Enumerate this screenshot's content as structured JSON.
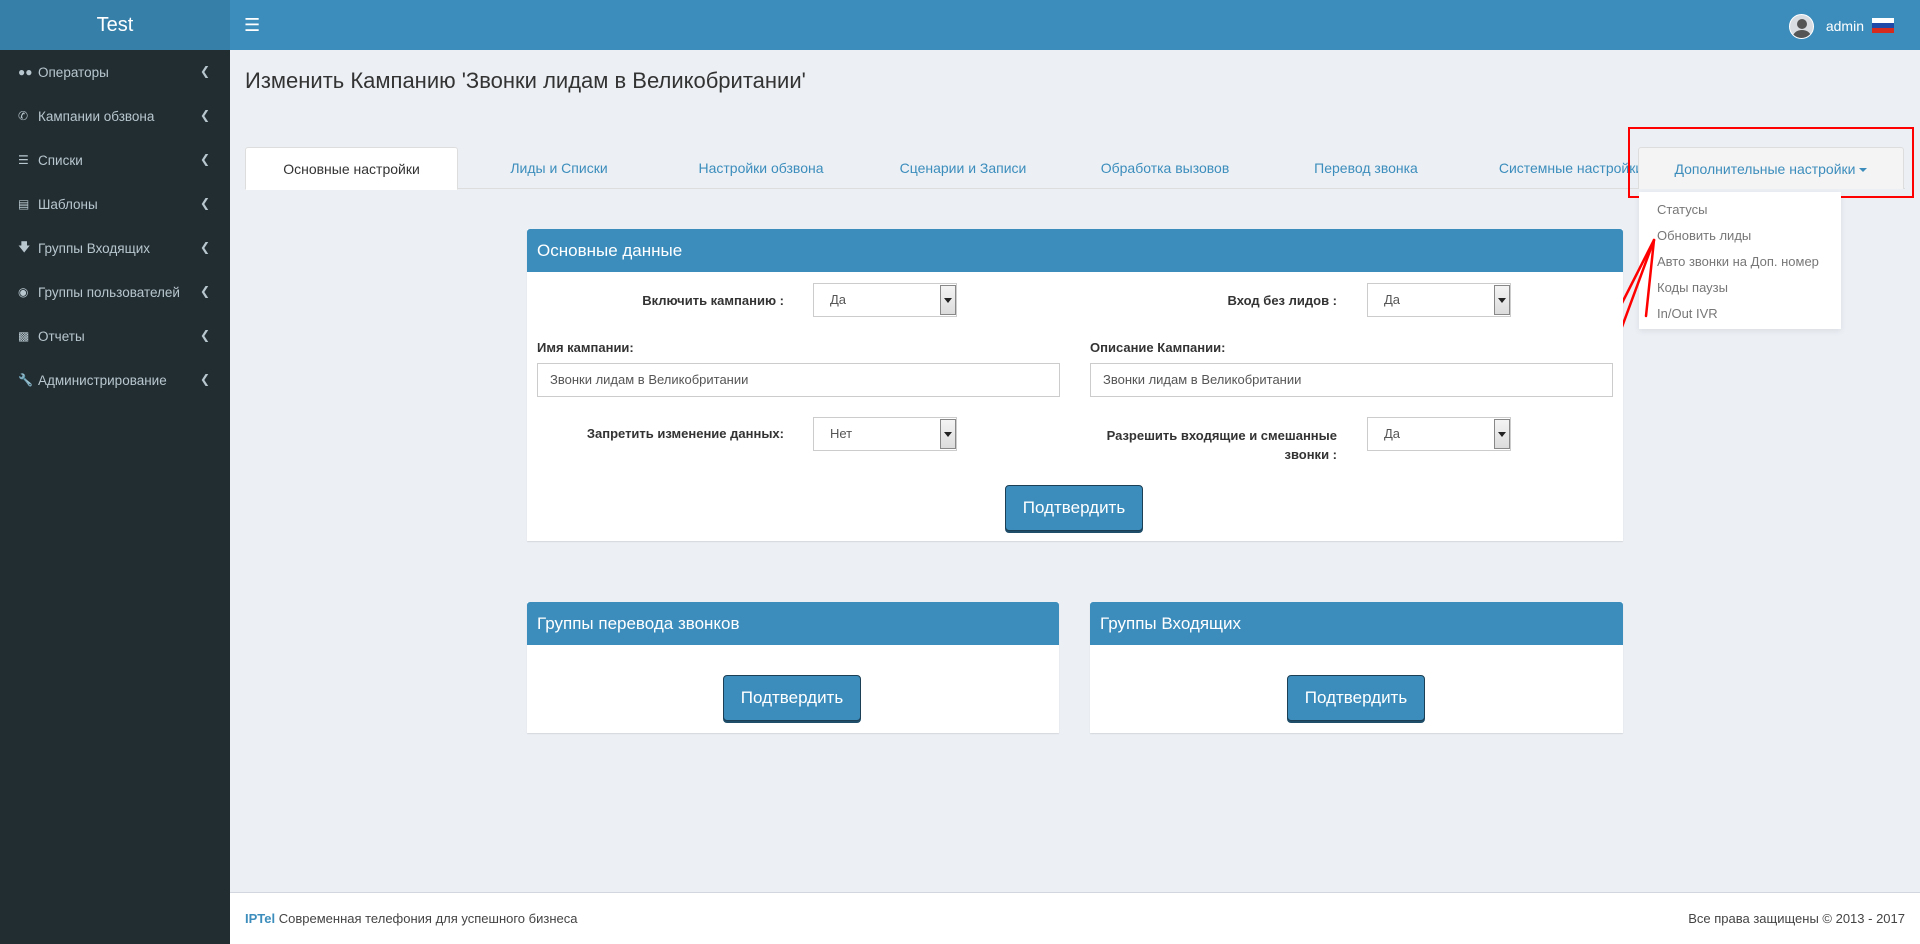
{
  "app": {
    "title": "Test"
  },
  "user": {
    "name": "admin"
  },
  "flag_colors": [
    "#ffffff",
    "#1f4aa8",
    "#d52b1e"
  ],
  "sidebar": {
    "items": [
      {
        "label": "Операторы",
        "icon": "users-icon"
      },
      {
        "label": "Кампании обзвона",
        "icon": "phone-icon"
      },
      {
        "label": "Списки",
        "icon": "list-icon"
      },
      {
        "label": "Шаблоны",
        "icon": "file-icon"
      },
      {
        "label": "Группы Входящих",
        "icon": "arrow-down-icon"
      },
      {
        "label": "Группы пользователей",
        "icon": "user-circle-icon"
      },
      {
        "label": "Отчеты",
        "icon": "bar-chart-icon"
      },
      {
        "label": "Администрирование",
        "icon": "wrench-icon"
      }
    ]
  },
  "page": {
    "title": "Изменить Кампанию 'Звонки лидам в Великобритании'"
  },
  "tabs": [
    {
      "label": "Основные настройки",
      "active": true
    },
    {
      "label": "Лиды и Списки"
    },
    {
      "label": "Настройки обзвона"
    },
    {
      "label": "Сценарии и Записи"
    },
    {
      "label": "Обработка вызовов"
    },
    {
      "label": "Перевод звонка"
    },
    {
      "label": "Системные настройки"
    },
    {
      "label": "Дополнительные настройки"
    }
  ],
  "dropdown": {
    "items": [
      "Статусы",
      "Обновить лиды",
      "Авто звонки на Доп. номер",
      "Коды паузы",
      "In/Out IVR"
    ]
  },
  "main_box": {
    "title": "Основные данные",
    "enable_campaign": {
      "label": "Включить кампанию :",
      "value": "Да"
    },
    "no_leads_login": {
      "label": "Вход без лидов :",
      "value": "Да"
    },
    "campaign_name": {
      "label": "Имя кампании:",
      "value": "Звонки лидам в Великобритании"
    },
    "campaign_description": {
      "label": "Описание Кампании:",
      "value": "Звонки лидам в Великобритании"
    },
    "forbid_data_change": {
      "label": "Запретить изменение данных:",
      "value": "Нет"
    },
    "allow_inbound_blended": {
      "label_line1": "Разрешить входящие и смешанные",
      "label_line2": "звонки :",
      "value": "Да"
    },
    "submit_label": "Подтвердить"
  },
  "transfer_box": {
    "title": "Группы перевода звонков",
    "submit_label": "Подтвердить"
  },
  "inbound_box": {
    "title": "Группы Входящих",
    "submit_label": "Подтвердить"
  },
  "footer": {
    "brand": "IPTel",
    "tagline": "Современная телефония для успешного бизнеса",
    "copyright": "Все права защищены © 2013 - 2017"
  }
}
